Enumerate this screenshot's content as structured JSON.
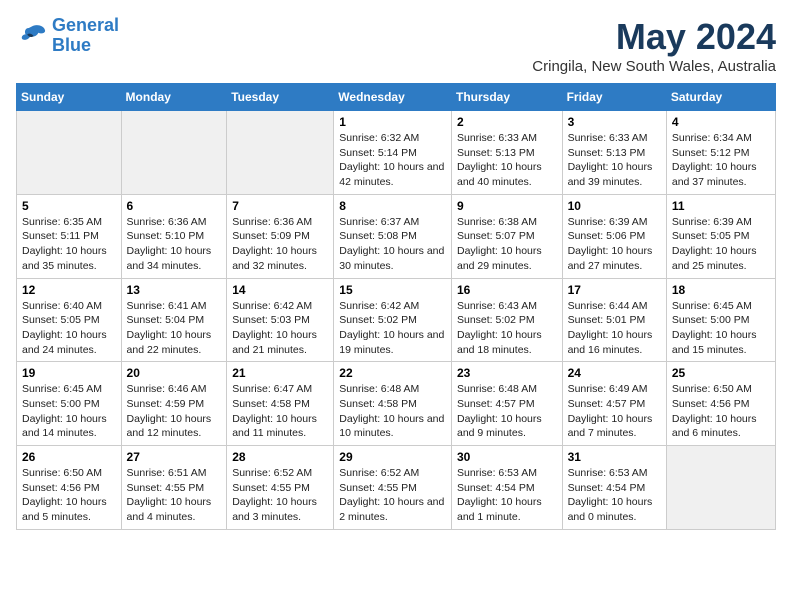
{
  "header": {
    "logo_line1": "General",
    "logo_line2": "Blue",
    "title": "May 2024",
    "subtitle": "Cringila, New South Wales, Australia"
  },
  "days_of_week": [
    "Sunday",
    "Monday",
    "Tuesday",
    "Wednesday",
    "Thursday",
    "Friday",
    "Saturday"
  ],
  "weeks": [
    [
      {
        "day": "",
        "empty": true
      },
      {
        "day": "",
        "empty": true
      },
      {
        "day": "",
        "empty": true
      },
      {
        "day": "1",
        "sunrise": "6:32 AM",
        "sunset": "5:14 PM",
        "daylight": "10 hours and 42 minutes."
      },
      {
        "day": "2",
        "sunrise": "6:33 AM",
        "sunset": "5:13 PM",
        "daylight": "10 hours and 40 minutes."
      },
      {
        "day": "3",
        "sunrise": "6:33 AM",
        "sunset": "5:13 PM",
        "daylight": "10 hours and 39 minutes."
      },
      {
        "day": "4",
        "sunrise": "6:34 AM",
        "sunset": "5:12 PM",
        "daylight": "10 hours and 37 minutes."
      }
    ],
    [
      {
        "day": "5",
        "sunrise": "6:35 AM",
        "sunset": "5:11 PM",
        "daylight": "10 hours and 35 minutes."
      },
      {
        "day": "6",
        "sunrise": "6:36 AM",
        "sunset": "5:10 PM",
        "daylight": "10 hours and 34 minutes."
      },
      {
        "day": "7",
        "sunrise": "6:36 AM",
        "sunset": "5:09 PM",
        "daylight": "10 hours and 32 minutes."
      },
      {
        "day": "8",
        "sunrise": "6:37 AM",
        "sunset": "5:08 PM",
        "daylight": "10 hours and 30 minutes."
      },
      {
        "day": "9",
        "sunrise": "6:38 AM",
        "sunset": "5:07 PM",
        "daylight": "10 hours and 29 minutes."
      },
      {
        "day": "10",
        "sunrise": "6:39 AM",
        "sunset": "5:06 PM",
        "daylight": "10 hours and 27 minutes."
      },
      {
        "day": "11",
        "sunrise": "6:39 AM",
        "sunset": "5:05 PM",
        "daylight": "10 hours and 25 minutes."
      }
    ],
    [
      {
        "day": "12",
        "sunrise": "6:40 AM",
        "sunset": "5:05 PM",
        "daylight": "10 hours and 24 minutes."
      },
      {
        "day": "13",
        "sunrise": "6:41 AM",
        "sunset": "5:04 PM",
        "daylight": "10 hours and 22 minutes."
      },
      {
        "day": "14",
        "sunrise": "6:42 AM",
        "sunset": "5:03 PM",
        "daylight": "10 hours and 21 minutes."
      },
      {
        "day": "15",
        "sunrise": "6:42 AM",
        "sunset": "5:02 PM",
        "daylight": "10 hours and 19 minutes."
      },
      {
        "day": "16",
        "sunrise": "6:43 AM",
        "sunset": "5:02 PM",
        "daylight": "10 hours and 18 minutes."
      },
      {
        "day": "17",
        "sunrise": "6:44 AM",
        "sunset": "5:01 PM",
        "daylight": "10 hours and 16 minutes."
      },
      {
        "day": "18",
        "sunrise": "6:45 AM",
        "sunset": "5:00 PM",
        "daylight": "10 hours and 15 minutes."
      }
    ],
    [
      {
        "day": "19",
        "sunrise": "6:45 AM",
        "sunset": "5:00 PM",
        "daylight": "10 hours and 14 minutes."
      },
      {
        "day": "20",
        "sunrise": "6:46 AM",
        "sunset": "4:59 PM",
        "daylight": "10 hours and 12 minutes."
      },
      {
        "day": "21",
        "sunrise": "6:47 AM",
        "sunset": "4:58 PM",
        "daylight": "10 hours and 11 minutes."
      },
      {
        "day": "22",
        "sunrise": "6:48 AM",
        "sunset": "4:58 PM",
        "daylight": "10 hours and 10 minutes."
      },
      {
        "day": "23",
        "sunrise": "6:48 AM",
        "sunset": "4:57 PM",
        "daylight": "10 hours and 9 minutes."
      },
      {
        "day": "24",
        "sunrise": "6:49 AM",
        "sunset": "4:57 PM",
        "daylight": "10 hours and 7 minutes."
      },
      {
        "day": "25",
        "sunrise": "6:50 AM",
        "sunset": "4:56 PM",
        "daylight": "10 hours and 6 minutes."
      }
    ],
    [
      {
        "day": "26",
        "sunrise": "6:50 AM",
        "sunset": "4:56 PM",
        "daylight": "10 hours and 5 minutes."
      },
      {
        "day": "27",
        "sunrise": "6:51 AM",
        "sunset": "4:55 PM",
        "daylight": "10 hours and 4 minutes."
      },
      {
        "day": "28",
        "sunrise": "6:52 AM",
        "sunset": "4:55 PM",
        "daylight": "10 hours and 3 minutes."
      },
      {
        "day": "29",
        "sunrise": "6:52 AM",
        "sunset": "4:55 PM",
        "daylight": "10 hours and 2 minutes."
      },
      {
        "day": "30",
        "sunrise": "6:53 AM",
        "sunset": "4:54 PM",
        "daylight": "10 hours and 1 minute."
      },
      {
        "day": "31",
        "sunrise": "6:53 AM",
        "sunset": "4:54 PM",
        "daylight": "10 hours and 0 minutes."
      },
      {
        "day": "",
        "empty": true
      }
    ]
  ],
  "labels": {
    "sunrise_prefix": "Sunrise: ",
    "sunset_prefix": "Sunset: ",
    "daylight_prefix": "Daylight: "
  }
}
